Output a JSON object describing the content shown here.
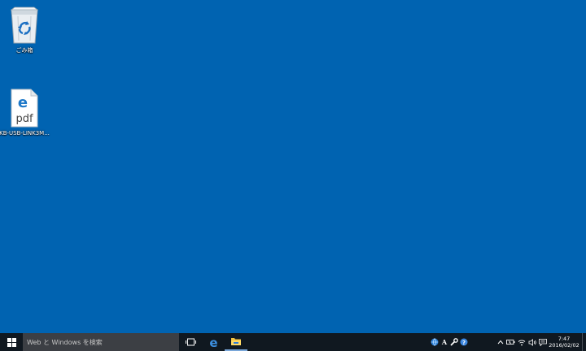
{
  "desktop": {
    "background": "#0063b1",
    "icons": [
      {
        "label": "ごみ箱",
        "icon": "recycle-bin-icon"
      },
      {
        "label": "KB-USB-LINK3M...",
        "icon": "pdf-file-icon",
        "glyph_text": "pdf"
      }
    ]
  },
  "taskbar": {
    "search_placeholder": "Web と Windows を検索",
    "pinned": [
      "task-view-icon",
      "edge-icon",
      "file-explorer-icon"
    ],
    "tray_apps": [
      "network-globe-icon",
      "ime-a-icon",
      "wrench-icon",
      "help-icon"
    ],
    "system_tray": [
      "chevron-up-icon",
      "battery-icon",
      "wifi-icon",
      "speaker-icon",
      "action-center-icon"
    ],
    "clock": {
      "time": "7:47",
      "date": "2016/02/02"
    }
  }
}
